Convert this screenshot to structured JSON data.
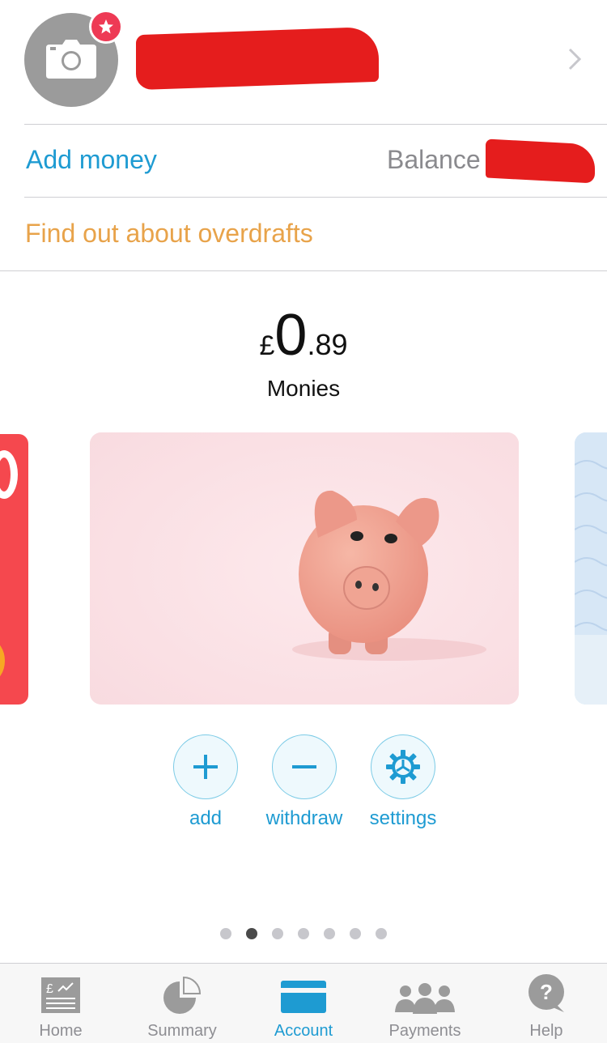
{
  "profile": {
    "avatar_icon": "camera-icon",
    "badge_icon": "star-icon",
    "name_redacted": true
  },
  "account_row": {
    "add_money_label": "Add money",
    "balance_label": "Balance"
  },
  "overdraft_row": {
    "label": "Find out about overdrafts"
  },
  "pot": {
    "currency": "£",
    "whole": "0",
    "decimal": ".89",
    "name": "Monies"
  },
  "actions": [
    {
      "label": "add",
      "icon": "plus-icon"
    },
    {
      "label": "withdraw",
      "icon": "minus-icon"
    },
    {
      "label": "settings",
      "icon": "gear-icon"
    }
  ],
  "pager": {
    "count": 7,
    "active_index": 1
  },
  "tabbar": {
    "items": [
      {
        "label": "Home",
        "icon": "home-icon"
      },
      {
        "label": "Summary",
        "icon": "pie-chart-icon"
      },
      {
        "label": "Account",
        "icon": "card-icon"
      },
      {
        "label": "Payments",
        "icon": "people-icon"
      },
      {
        "label": "Help",
        "icon": "help-icon"
      }
    ],
    "active_index": 2
  },
  "colors": {
    "accent": "#1e9bd2",
    "overdraft": "#e8a34a",
    "redaction": "#e51d1d",
    "card_left": "#f5484e"
  }
}
